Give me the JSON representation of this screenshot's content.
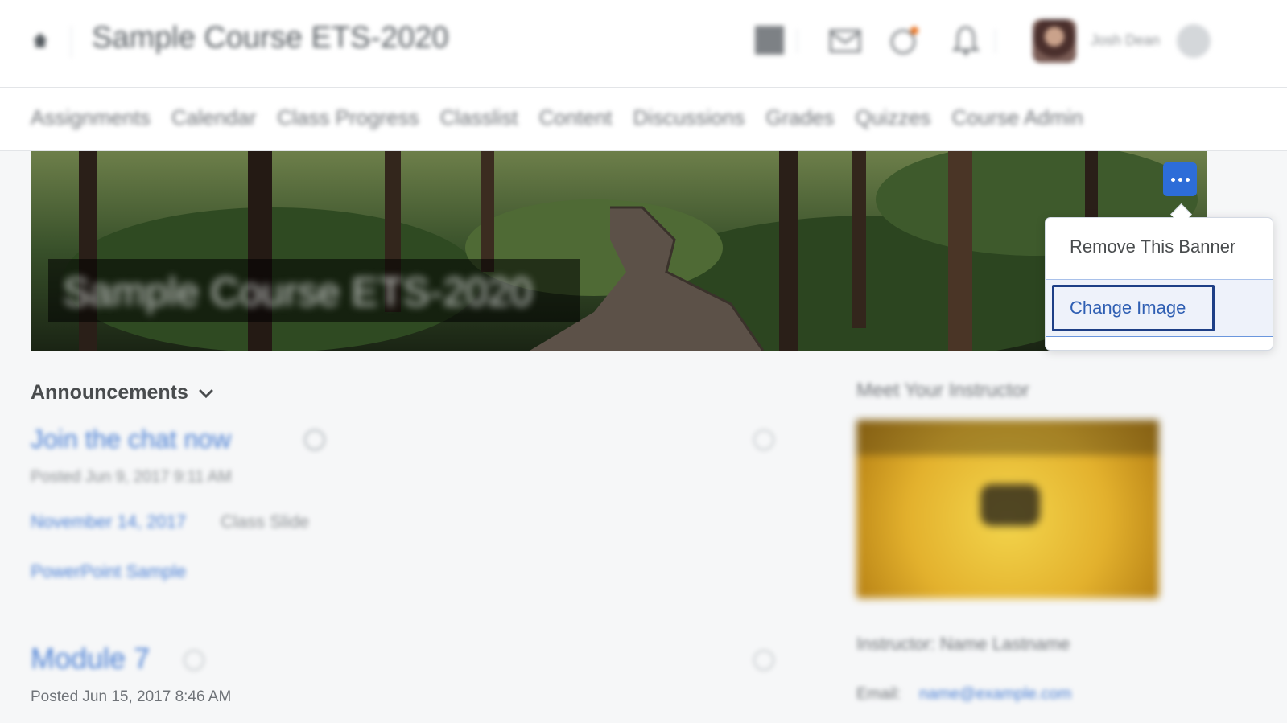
{
  "header": {
    "course_title": "Sample Course ETS-2020",
    "user_name": "Josh Dean"
  },
  "nav": {
    "items": [
      "Assignments",
      "Calendar",
      "Class Progress",
      "Classlist",
      "Content",
      "Discussions",
      "Grades",
      "Quizzes",
      "Course Admin"
    ]
  },
  "banner": {
    "title": "Sample Course ETS-2020",
    "menu": {
      "remove_label": "Remove This Banner",
      "change_label": "Change Image"
    }
  },
  "announcements": {
    "heading": "Announcements",
    "items": [
      {
        "title": "Join the chat now",
        "meta": "Posted Jun 9, 2017 9:11 AM",
        "link": "November 14, 2017",
        "link_suffix": "Class Slide",
        "extra_link": "PowerPoint Sample"
      },
      {
        "title": "Module 7",
        "meta": "Posted Jun 15, 2017 8:46 AM"
      }
    ]
  },
  "widget": {
    "title": "Meet Your Instructor",
    "line1": "Instructor: Name Lastname",
    "line2_label": "Email:",
    "line2_link": "name@example.com"
  },
  "colors": {
    "accent": "#2d6dd8",
    "focus_ring": "#1e3f86",
    "link": "#4a7fd4"
  }
}
